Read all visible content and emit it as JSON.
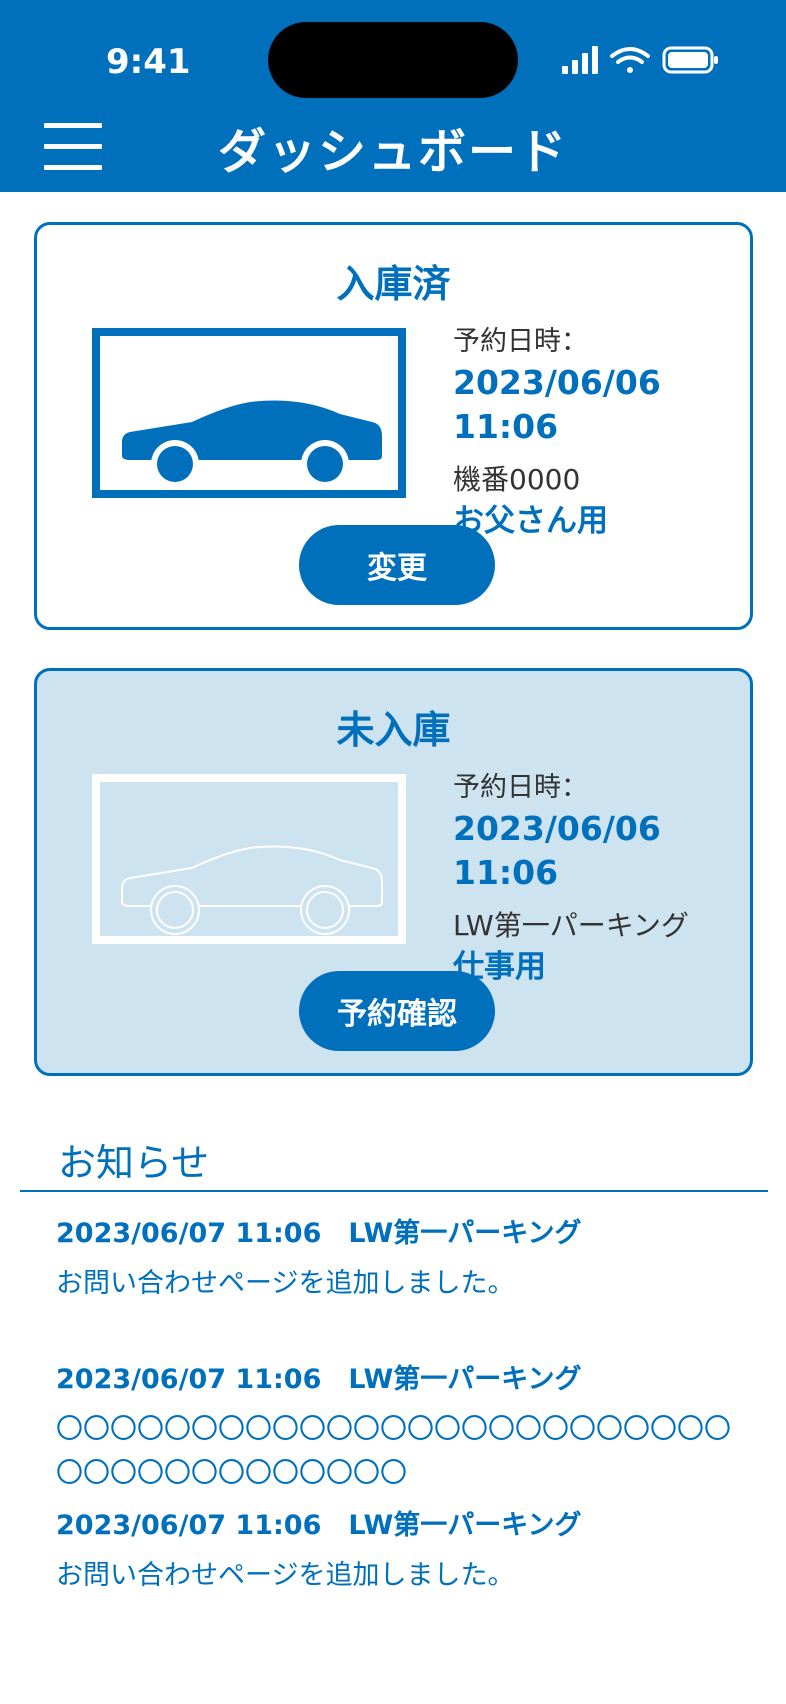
{
  "status_bar": {
    "time": "9:41"
  },
  "header": {
    "title": "ダッシュボード"
  },
  "cards": [
    {
      "title": "入庫済",
      "date_label": "予約日時：",
      "date": "2023/06/06 11:06",
      "sub": "機番0000",
      "name": "お父さん用",
      "button": "変更"
    },
    {
      "title": "未入庫",
      "date_label": "予約日時：",
      "date": "2023/06/06 11:06",
      "sub": "LW第一パーキング",
      "name": "仕事用",
      "button": "予約確認"
    }
  ],
  "news": {
    "heading": "お知らせ",
    "items": [
      {
        "meta": "2023/06/07 11:06　LW第一パーキング",
        "body": "お問い合わせページを追加しました。"
      },
      {
        "meta": "2023/06/07 11:06　LW第一パーキング",
        "body": "〇〇〇〇〇〇〇〇〇〇〇〇〇〇〇〇〇〇〇〇〇〇〇〇〇〇〇〇〇〇〇〇〇〇〇〇〇〇"
      },
      {
        "meta": "2023/06/07 11:06　LW第一パーキング",
        "body": "お問い合わせページを追加しました。"
      }
    ]
  },
  "colors": {
    "primary": "#0070bd",
    "pending_bg": "#cde3f0"
  }
}
